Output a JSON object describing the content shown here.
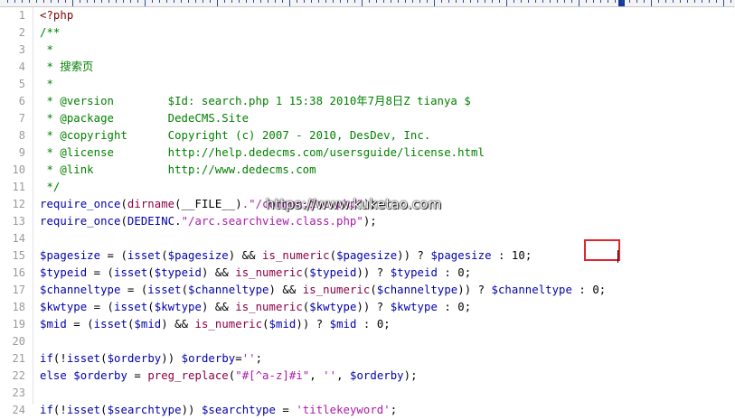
{
  "editor": {
    "lines": [
      {
        "n": "1",
        "parts": [
          {
            "t": "<?php",
            "c": "php"
          }
        ]
      },
      {
        "n": "2",
        "parts": [
          {
            "t": "/**",
            "c": "com"
          }
        ]
      },
      {
        "n": "3",
        "parts": [
          {
            "t": " *",
            "c": "com"
          }
        ]
      },
      {
        "n": "4",
        "parts": [
          {
            "t": " * 搜索页",
            "c": "com"
          }
        ]
      },
      {
        "n": "5",
        "parts": [
          {
            "t": " *",
            "c": "com"
          }
        ]
      },
      {
        "n": "6",
        "parts": [
          {
            "t": " * @version        $Id: search.php 1 15:38 2010年7月8日Z tianya $",
            "c": "com"
          }
        ]
      },
      {
        "n": "7",
        "parts": [
          {
            "t": " * @package        DedeCMS.Site",
            "c": "com"
          }
        ]
      },
      {
        "n": "8",
        "parts": [
          {
            "t": " * @copyright      Copyright (c) 2007 - 2010, DesDev, Inc.",
            "c": "com"
          }
        ]
      },
      {
        "n": "9",
        "parts": [
          {
            "t": " * @license        http://help.dedecms.com/usersguide/license.html",
            "c": "com"
          }
        ]
      },
      {
        "n": "10",
        "parts": [
          {
            "t": " * @link           http://www.dedecms.com",
            "c": "com"
          }
        ]
      },
      {
        "n": "11",
        "parts": [
          {
            "t": " */",
            "c": "com"
          }
        ]
      },
      {
        "n": "12",
        "parts": [
          {
            "t": "require_once",
            "c": "kw"
          },
          {
            "t": "(",
            "c": "op"
          },
          {
            "t": "dirname",
            "c": "fn"
          },
          {
            "t": "(",
            "c": "op"
          },
          {
            "t": "__FILE__",
            "c": "op"
          },
          {
            "t": ")",
            "c": "op"
          },
          {
            "t": ".\"/common.inc.php\"",
            "c": "str"
          },
          {
            "t": ");",
            "c": "op"
          }
        ]
      },
      {
        "n": "13",
        "parts": [
          {
            "t": "require_once",
            "c": "kw"
          },
          {
            "t": "(",
            "c": "op"
          },
          {
            "t": "DEDEINC",
            "c": "def"
          },
          {
            "t": ".",
            "c": "op"
          },
          {
            "t": "\"/arc.searchview.class.php\"",
            "c": "str"
          },
          {
            "t": ");",
            "c": "op"
          }
        ]
      },
      {
        "n": "14",
        "parts": [
          {
            "t": "",
            "c": "op"
          }
        ]
      },
      {
        "n": "15",
        "parts": [
          {
            "t": "$pagesize",
            "c": "var"
          },
          {
            "t": " = (",
            "c": "op"
          },
          {
            "t": "isset",
            "c": "kw"
          },
          {
            "t": "(",
            "c": "op"
          },
          {
            "t": "$pagesize",
            "c": "var"
          },
          {
            "t": ") && ",
            "c": "op"
          },
          {
            "t": "is_numeric",
            "c": "fn"
          },
          {
            "t": "(",
            "c": "op"
          },
          {
            "t": "$pagesize",
            "c": "var"
          },
          {
            "t": ")) ? ",
            "c": "op"
          },
          {
            "t": "$pagesize",
            "c": "var"
          },
          {
            "t": " : ",
            "c": "op"
          },
          {
            "t": "10",
            "c": "op"
          },
          {
            "t": ";",
            "c": "op"
          }
        ]
      },
      {
        "n": "16",
        "parts": [
          {
            "t": "$typeid",
            "c": "var"
          },
          {
            "t": " = (",
            "c": "op"
          },
          {
            "t": "isset",
            "c": "kw"
          },
          {
            "t": "(",
            "c": "op"
          },
          {
            "t": "$typeid",
            "c": "var"
          },
          {
            "t": ") && ",
            "c": "op"
          },
          {
            "t": "is_numeric",
            "c": "fn"
          },
          {
            "t": "(",
            "c": "op"
          },
          {
            "t": "$typeid",
            "c": "var"
          },
          {
            "t": ")) ? ",
            "c": "op"
          },
          {
            "t": "$typeid",
            "c": "var"
          },
          {
            "t": " : 0;",
            "c": "op"
          }
        ]
      },
      {
        "n": "17",
        "parts": [
          {
            "t": "$channeltype",
            "c": "var"
          },
          {
            "t": " = (",
            "c": "op"
          },
          {
            "t": "isset",
            "c": "kw"
          },
          {
            "t": "(",
            "c": "op"
          },
          {
            "t": "$channeltype",
            "c": "var"
          },
          {
            "t": ") && ",
            "c": "op"
          },
          {
            "t": "is_numeric",
            "c": "fn"
          },
          {
            "t": "(",
            "c": "op"
          },
          {
            "t": "$channeltype",
            "c": "var"
          },
          {
            "t": ")) ? ",
            "c": "op"
          },
          {
            "t": "$channeltype",
            "c": "var"
          },
          {
            "t": " : 0;",
            "c": "op"
          }
        ]
      },
      {
        "n": "18",
        "parts": [
          {
            "t": "$kwtype",
            "c": "var"
          },
          {
            "t": " = (",
            "c": "op"
          },
          {
            "t": "isset",
            "c": "kw"
          },
          {
            "t": "(",
            "c": "op"
          },
          {
            "t": "$kwtype",
            "c": "var"
          },
          {
            "t": ") && ",
            "c": "op"
          },
          {
            "t": "is_numeric",
            "c": "fn"
          },
          {
            "t": "(",
            "c": "op"
          },
          {
            "t": "$kwtype",
            "c": "var"
          },
          {
            "t": ")) ? ",
            "c": "op"
          },
          {
            "t": "$kwtype",
            "c": "var"
          },
          {
            "t": " : 0;",
            "c": "op"
          }
        ]
      },
      {
        "n": "19",
        "parts": [
          {
            "t": "$mid",
            "c": "var"
          },
          {
            "t": " = (",
            "c": "op"
          },
          {
            "t": "isset",
            "c": "kw"
          },
          {
            "t": "(",
            "c": "op"
          },
          {
            "t": "$mid",
            "c": "var"
          },
          {
            "t": ") && ",
            "c": "op"
          },
          {
            "t": "is_numeric",
            "c": "fn"
          },
          {
            "t": "(",
            "c": "op"
          },
          {
            "t": "$mid",
            "c": "var"
          },
          {
            "t": ")) ? ",
            "c": "op"
          },
          {
            "t": "$mid",
            "c": "var"
          },
          {
            "t": " : 0;",
            "c": "op"
          }
        ]
      },
      {
        "n": "20",
        "parts": [
          {
            "t": "",
            "c": "op"
          }
        ]
      },
      {
        "n": "21",
        "parts": [
          {
            "t": "if",
            "c": "kw"
          },
          {
            "t": "(!",
            "c": "op"
          },
          {
            "t": "isset",
            "c": "kw"
          },
          {
            "t": "(",
            "c": "op"
          },
          {
            "t": "$orderby",
            "c": "var"
          },
          {
            "t": ")) ",
            "c": "op"
          },
          {
            "t": "$orderby",
            "c": "var"
          },
          {
            "t": "=",
            "c": "op"
          },
          {
            "t": "''",
            "c": "str"
          },
          {
            "t": ";",
            "c": "op"
          }
        ]
      },
      {
        "n": "22",
        "parts": [
          {
            "t": "else",
            "c": "kw"
          },
          {
            "t": " ",
            "c": "op"
          },
          {
            "t": "$orderby",
            "c": "var"
          },
          {
            "t": " = ",
            "c": "op"
          },
          {
            "t": "preg_replace",
            "c": "fn"
          },
          {
            "t": "(",
            "c": "op"
          },
          {
            "t": "\"#[^a-z]#i\"",
            "c": "str"
          },
          {
            "t": ", ",
            "c": "op"
          },
          {
            "t": "''",
            "c": "str"
          },
          {
            "t": ", ",
            "c": "op"
          },
          {
            "t": "$orderby",
            "c": "var"
          },
          {
            "t": ");",
            "c": "op"
          }
        ]
      },
      {
        "n": "23",
        "parts": [
          {
            "t": "",
            "c": "op"
          }
        ]
      },
      {
        "n": "24",
        "parts": [
          {
            "t": "if",
            "c": "kw"
          },
          {
            "t": "(!",
            "c": "op"
          },
          {
            "t": "isset",
            "c": "kw"
          },
          {
            "t": "(",
            "c": "op"
          },
          {
            "t": "$searchtype",
            "c": "var"
          },
          {
            "t": ")) ",
            "c": "op"
          },
          {
            "t": "$searchtype",
            "c": "var"
          },
          {
            "t": " = ",
            "c": "op"
          },
          {
            "t": "'titlekeyword'",
            "c": "str"
          },
          {
            "t": ";",
            "c": "op"
          }
        ]
      }
    ]
  },
  "watermark": "https://www.kuketao.com",
  "highlight": {
    "target_line": "15",
    "value": "10"
  },
  "colors": {
    "comment": "#008000",
    "variable": "#0000aa",
    "function": "#8b0045",
    "string": "#aa1aaa",
    "highlight_box": "#e0262a"
  }
}
